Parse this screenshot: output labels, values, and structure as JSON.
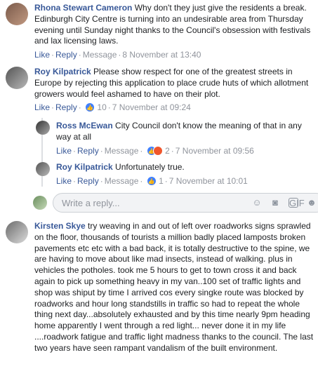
{
  "comments": [
    {
      "name": "Rhona Stewart Cameron",
      "text": "Why don't they just give the residents a break. Edinburgh City Centre is turning into an undesirable area from Thursday evening until Sunday night thanks to the Council's obsession with festivals and lax licensing laws.",
      "like": "Like",
      "reply": "Reply",
      "message": "Message",
      "time": "8 November at 13:40"
    },
    {
      "name": "Roy Kilpatrick",
      "text": "Please show respect for one of the greatest streets in Europe by rejecting this application to place crude huts of which allotment growers would feel ashamed to have on their plot.",
      "like": "Like",
      "reply": "Reply",
      "reaction_count": "10",
      "time": "7 November at 09:24"
    },
    {
      "name": "Ross McEwan",
      "text": "City Council don't know the meaning of that in any way at all",
      "like": "Like",
      "reply": "Reply",
      "message": "Message",
      "reaction_count": "2",
      "time": "7 November at 09:56"
    },
    {
      "name": "Roy Kilpatrick",
      "text": "Unfortunately true.",
      "like": "Like",
      "reply": "Reply",
      "message": "Message",
      "reaction_count": "1",
      "time": "7 November at 10:01"
    },
    {
      "name": "Kirsten Skye",
      "text": "try weaving in and out of left over roadworks signs sprawled on the floor, thousands of tourists a million badly placed lamposts broken pavements etc etc with a bad back, it is totally destructive to the spine, we are having to move about like mad insects, instead of walking. plus in vehicles the potholes. took me 5 hours to get to town cross it and back again to pick up something heavy in my van..100 set of traffic lights and shop was shiput by time I arrived cos every singke route was blocked by roadworks and hour long standstills in traffic so had to repeat the whole thing next day...absolutely exhausted and by this time nearly 9pm heading home apparently I went through a red light... never done it in my life ....roadwork fatigue and traffic light madness thanks to the council. The last two years have seen rampant vandalism of the built environment."
    }
  ],
  "reply_input": {
    "placeholder": "Write a reply..."
  },
  "icons": [
    "smiley-icon",
    "camera-icon",
    "gif-icon",
    "sticker-icon"
  ],
  "colors": {
    "link": "#385898",
    "muted": "#90949c",
    "like_reaction": "#4080ff",
    "angry_reaction": "#f0562c"
  }
}
